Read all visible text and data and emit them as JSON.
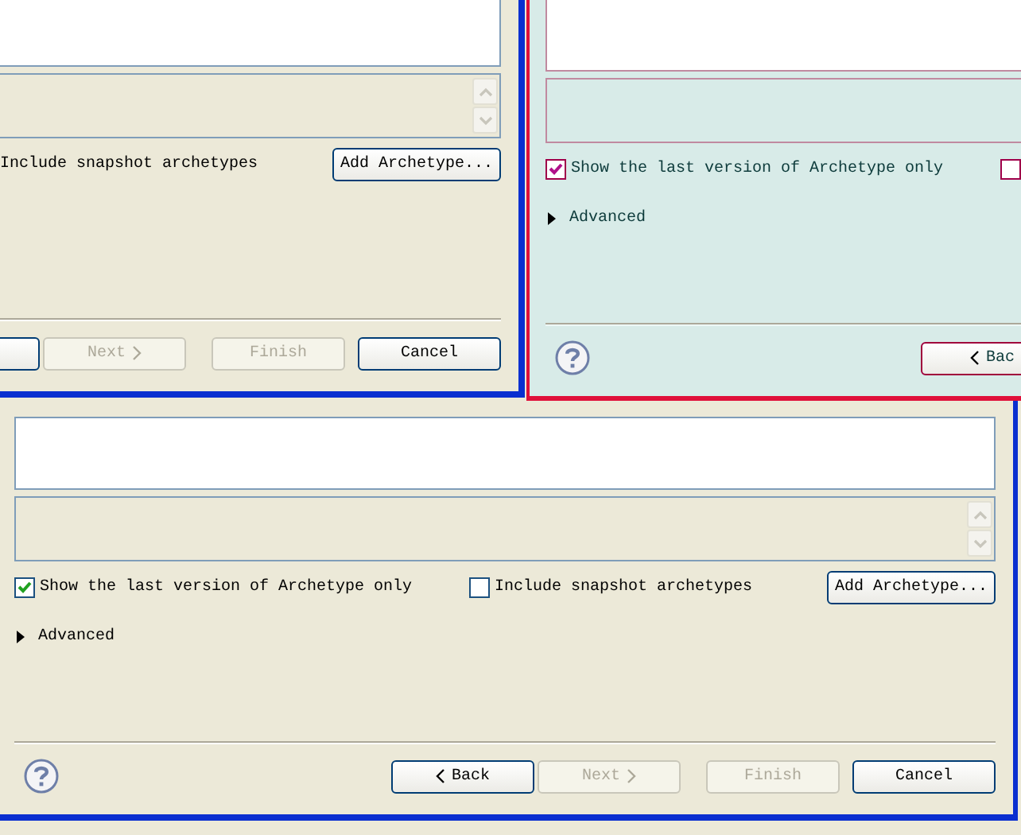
{
  "windows": [
    {
      "include_snapshot": {
        "label": "Include snapshot archetypes"
      },
      "add_button": {
        "label": "Add Archetype..."
      },
      "panel": {
        "scroll_buttons": true
      },
      "buttons": [
        {
          "kind": "back",
          "disabled": false
        },
        {
          "kind": "next",
          "label": "Next",
          "disabled": true
        },
        {
          "kind": "finish",
          "label": "Finish",
          "disabled": true
        },
        {
          "kind": "cancel",
          "label": "Cancel",
          "disabled": false
        }
      ]
    },
    {
      "show_last_version": {
        "label": "Show the last version of Archetype only",
        "checked": true
      },
      "include_snapshot": {
        "checked": false
      },
      "advanced": {
        "label": "Advanced",
        "expanded": false
      },
      "help_button": true,
      "buttons": [
        {
          "kind": "back",
          "label": "Bac",
          "disabled": false
        }
      ]
    },
    {
      "show_last_version": {
        "label": "Show the last version of Archetype only",
        "checked": true
      },
      "include_snapshot": {
        "label": "Include snapshot archetypes",
        "checked": false
      },
      "add_button": {
        "label": "Add Archetype..."
      },
      "panel": {
        "scroll_buttons": true
      },
      "advanced": {
        "label": "Advanced",
        "expanded": false
      },
      "help_button": true,
      "buttons": [
        {
          "kind": "back",
          "label": "Back",
          "disabled": false
        },
        {
          "kind": "next",
          "label": "Next",
          "disabled": true
        },
        {
          "kind": "finish",
          "label": "Finish",
          "disabled": true
        },
        {
          "kind": "cancel",
          "label": "Cancel",
          "disabled": false
        }
      ]
    }
  ]
}
